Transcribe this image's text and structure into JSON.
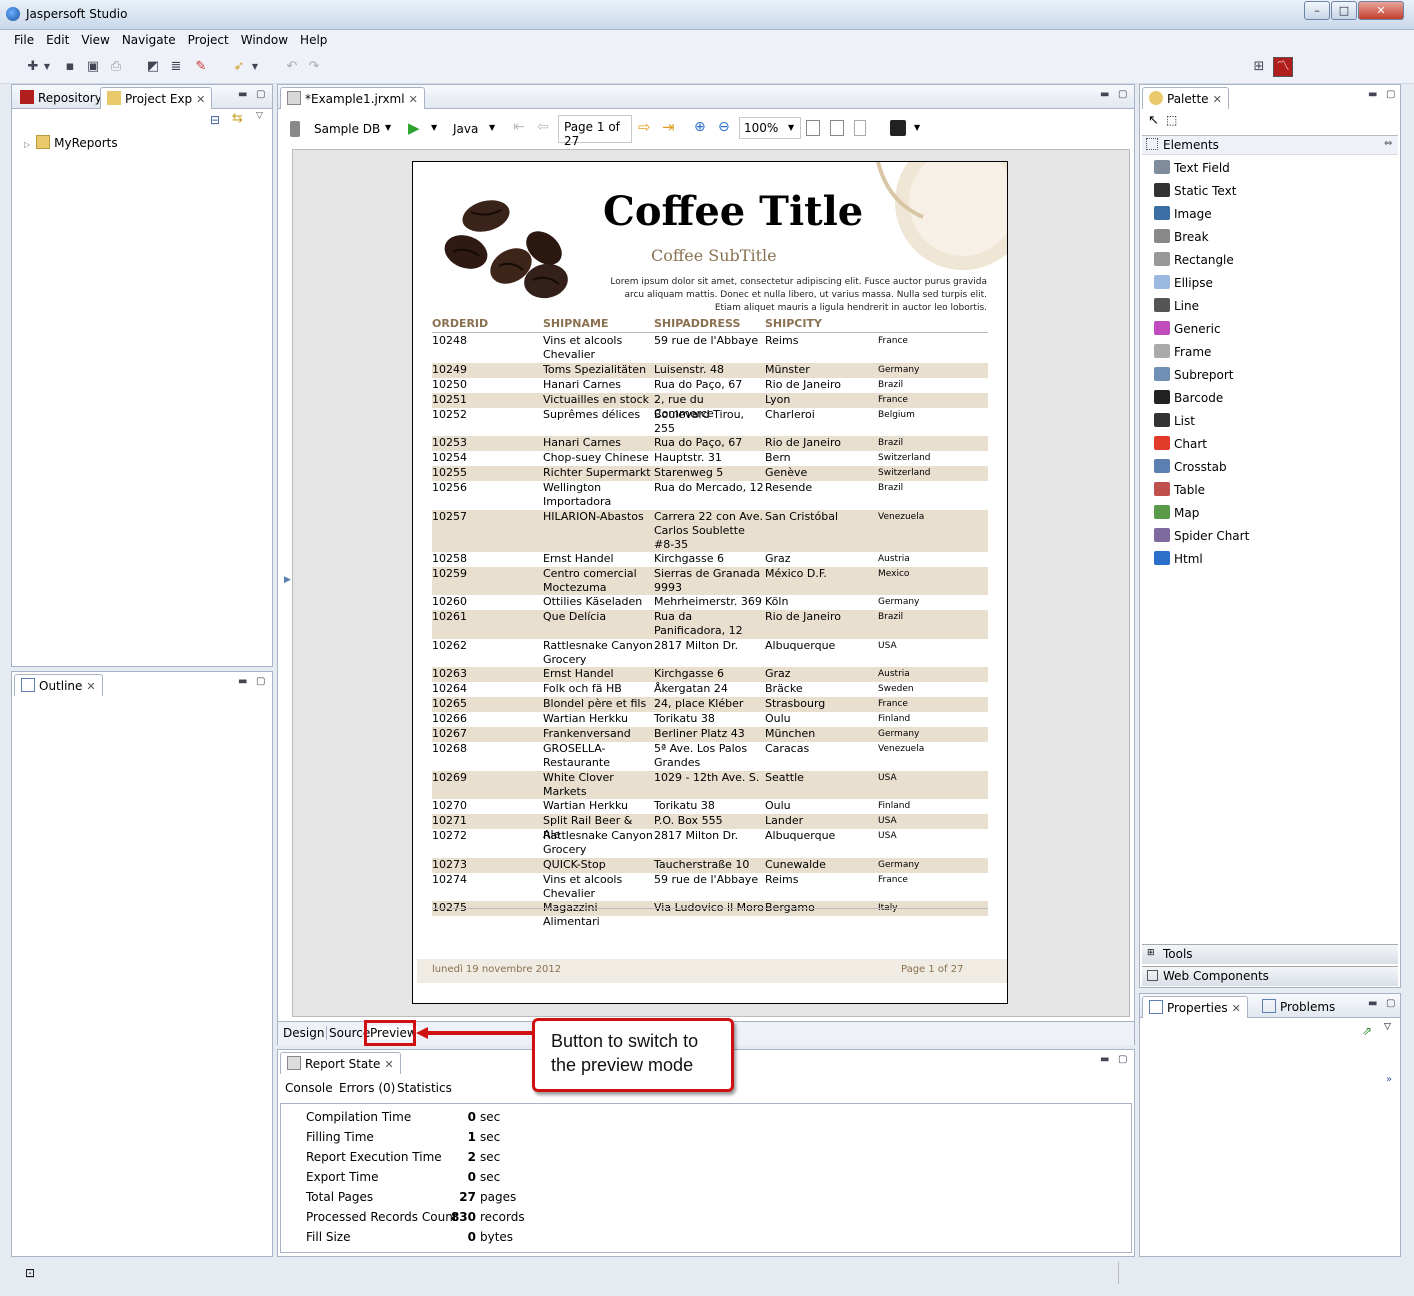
{
  "app": {
    "title": "Jaspersoft Studio"
  },
  "window_controls": {
    "minimize": "–",
    "maximize": "□",
    "close": "✕"
  },
  "menu": [
    "File",
    "Edit",
    "View",
    "Navigate",
    "Project",
    "Window",
    "Help"
  ],
  "left_panel": {
    "tabs": [
      "Repository",
      "Project Exp"
    ],
    "tree": [
      {
        "label": "MyReports"
      }
    ]
  },
  "outline_panel": {
    "tab": "Outline"
  },
  "editor": {
    "tab": "*Example1.jrxml",
    "datasource": "Sample DB",
    "language": "Java",
    "page_indicator": "Page 1 of 27",
    "zoom": "100%",
    "bottom_tabs": [
      "Design",
      "Source",
      "Preview"
    ]
  },
  "report": {
    "title": "Coffee Title",
    "subtitle": "Coffee SubTitle",
    "lorem": "Lorem ipsum dolor sit amet, consectetur adipiscing elit. Fusce auctor purus gravida arcu aliquam mattis. Donec et nulla libero, ut varius massa. Nulla sed turpis elit. Etiam aliquet mauris a ligula hendrerit in auctor leo lobortis.",
    "columns": [
      "ORDERID",
      "SHIPNAME",
      "SHIPADDRESS",
      "SHIPCITY"
    ],
    "rows": [
      {
        "id": "10248",
        "name": "Vins et alcools Chevalier",
        "addr": "59 rue de l'Abbaye",
        "city": "Reims",
        "country": "France",
        "lines": 2
      },
      {
        "id": "10249",
        "name": "Toms Spezialitäten",
        "addr": "Luisenstr. 48",
        "city": "Münster",
        "country": "Germany",
        "lines": 1
      },
      {
        "id": "10250",
        "name": "Hanari Carnes",
        "addr": "Rua do Paço, 67",
        "city": "Rio de Janeiro",
        "country": "Brazil",
        "lines": 1
      },
      {
        "id": "10251",
        "name": "Victuailles en stock",
        "addr": "2, rue du Commerce",
        "city": "Lyon",
        "country": "France",
        "lines": 1
      },
      {
        "id": "10252",
        "name": "Suprêmes délices",
        "addr": "Boulevard Tirou, 255",
        "city": "Charleroi",
        "country": "Belgium",
        "lines": 2
      },
      {
        "id": "10253",
        "name": "Hanari Carnes",
        "addr": "Rua do Paço, 67",
        "city": "Rio de Janeiro",
        "country": "Brazil",
        "lines": 1
      },
      {
        "id": "10254",
        "name": "Chop-suey Chinese",
        "addr": "Hauptstr. 31",
        "city": "Bern",
        "country": "Switzerland",
        "lines": 1
      },
      {
        "id": "10255",
        "name": "Richter Supermarkt",
        "addr": "Starenweg 5",
        "city": "Genève",
        "country": "Switzerland",
        "lines": 1
      },
      {
        "id": "10256",
        "name": "Wellington Importadora",
        "addr": "Rua do Mercado, 12",
        "city": "Resende",
        "country": "Brazil",
        "lines": 2
      },
      {
        "id": "10257",
        "name": "HILARION-Abastos",
        "addr": "Carrera 22 con Ave. Carlos Soublette #8-35",
        "city": "San Cristóbal",
        "country": "Venezuela",
        "lines": 3
      },
      {
        "id": "10258",
        "name": "Ernst Handel",
        "addr": "Kirchgasse 6",
        "city": "Graz",
        "country": "Austria",
        "lines": 1
      },
      {
        "id": "10259",
        "name": "Centro comercial Moctezuma",
        "addr": "Sierras de Granada 9993",
        "city": "México D.F.",
        "country": "Mexico",
        "lines": 2
      },
      {
        "id": "10260",
        "name": "Ottilies Käseladen",
        "addr": "Mehrheimerstr. 369",
        "city": "Köln",
        "country": "Germany",
        "lines": 1
      },
      {
        "id": "10261",
        "name": "Que Delícia",
        "addr": "Rua da Panificadora, 12",
        "city": "Rio de Janeiro",
        "country": "Brazil",
        "lines": 2
      },
      {
        "id": "10262",
        "name": "Rattlesnake Canyon Grocery",
        "addr": "2817 Milton Dr.",
        "city": "Albuquerque",
        "country": "USA",
        "lines": 2
      },
      {
        "id": "10263",
        "name": "Ernst Handel",
        "addr": "Kirchgasse 6",
        "city": "Graz",
        "country": "Austria",
        "lines": 1
      },
      {
        "id": "10264",
        "name": "Folk och fä HB",
        "addr": "Åkergatan 24",
        "city": "Bräcke",
        "country": "Sweden",
        "lines": 1
      },
      {
        "id": "10265",
        "name": "Blondel père et fils",
        "addr": "24, place Kléber",
        "city": "Strasbourg",
        "country": "France",
        "lines": 1
      },
      {
        "id": "10266",
        "name": "Wartian Herkku",
        "addr": "Torikatu 38",
        "city": "Oulu",
        "country": "Finland",
        "lines": 1
      },
      {
        "id": "10267",
        "name": "Frankenversand",
        "addr": "Berliner Platz 43",
        "city": "München",
        "country": "Germany",
        "lines": 1
      },
      {
        "id": "10268",
        "name": "GROSELLA-Restaurante",
        "addr": "5ª Ave. Los Palos Grandes",
        "city": "Caracas",
        "country": "Venezuela",
        "lines": 2
      },
      {
        "id": "10269",
        "name": "White Clover Markets",
        "addr": "1029 - 12th Ave. S.",
        "city": "Seattle",
        "country": "USA",
        "lines": 2
      },
      {
        "id": "10270",
        "name": "Wartian Herkku",
        "addr": "Torikatu 38",
        "city": "Oulu",
        "country": "Finland",
        "lines": 1
      },
      {
        "id": "10271",
        "name": "Split Rail Beer & Ale",
        "addr": "P.O. Box 555",
        "city": "Lander",
        "country": "USA",
        "lines": 1
      },
      {
        "id": "10272",
        "name": "Rattlesnake Canyon Grocery",
        "addr": "2817 Milton Dr.",
        "city": "Albuquerque",
        "country": "USA",
        "lines": 2
      },
      {
        "id": "10273",
        "name": "QUICK-Stop",
        "addr": "Taucherstraße 10",
        "city": "Cunewalde",
        "country": "Germany",
        "lines": 1
      },
      {
        "id": "10274",
        "name": "Vins et alcools Chevalier",
        "addr": "59 rue de l'Abbaye",
        "city": "Reims",
        "country": "France",
        "lines": 2
      },
      {
        "id": "10275",
        "name": "Magazzini Alimentari",
        "addr": "Via Ludovico il Moro",
        "city": "Bergamo",
        "country": "Italy",
        "lines": 1
      }
    ],
    "footer_date": "lunedì 19 novembre 2012",
    "footer_page": "Page 1 of 27"
  },
  "palette": {
    "tab": "Palette",
    "section": "Elements",
    "items": [
      {
        "label": "Text Field",
        "icon": "text-field-icon",
        "color": "#7f8c9c"
      },
      {
        "label": "Static Text",
        "icon": "static-text-icon",
        "color": "#333333"
      },
      {
        "label": "Image",
        "icon": "image-icon",
        "color": "#3a6ea5"
      },
      {
        "label": "Break",
        "icon": "break-icon",
        "color": "#888888"
      },
      {
        "label": "Rectangle",
        "icon": "rectangle-icon",
        "color": "#999999"
      },
      {
        "label": "Ellipse",
        "icon": "ellipse-icon",
        "color": "#9ab8e0"
      },
      {
        "label": "Line",
        "icon": "line-icon",
        "color": "#555555"
      },
      {
        "label": "Generic",
        "icon": "generic-icon",
        "color": "#c04bbd"
      },
      {
        "label": "Frame",
        "icon": "frame-icon",
        "color": "#aaaaaa"
      },
      {
        "label": "Subreport",
        "icon": "subreport-icon",
        "color": "#6f8fb5"
      },
      {
        "label": "Barcode",
        "icon": "barcode-icon",
        "color": "#222222"
      },
      {
        "label": "List",
        "icon": "list-icon",
        "color": "#333333"
      },
      {
        "label": "Chart",
        "icon": "chart-icon",
        "color": "#e23b2a"
      },
      {
        "label": "Crosstab",
        "icon": "crosstab-icon",
        "color": "#5b7fb0"
      },
      {
        "label": "Table",
        "icon": "table-icon",
        "color": "#c0504d"
      },
      {
        "label": "Map",
        "icon": "map-icon",
        "color": "#5a9a4a"
      },
      {
        "label": "Spider Chart",
        "icon": "spider-chart-icon",
        "color": "#7f6aa0"
      },
      {
        "label": "Html",
        "icon": "html-icon",
        "color": "#2a6fc9"
      }
    ],
    "tools": "Tools",
    "web_components": "Web Components"
  },
  "properties_panel": {
    "tabs": [
      "Properties",
      "Problems"
    ]
  },
  "report_state": {
    "tab": "Report State",
    "subtabs": [
      "Console",
      "Errors (0)",
      "Statistics"
    ],
    "stats": [
      {
        "label": "Compilation Time",
        "value": "0",
        "unit": "sec"
      },
      {
        "label": "Filling Time",
        "value": "1",
        "unit": "sec"
      },
      {
        "label": "Report Execution Time",
        "value": "2",
        "unit": "sec"
      },
      {
        "label": "Export Time",
        "value": "0",
        "unit": "sec"
      },
      {
        "label": "Total Pages",
        "value": "27",
        "unit": "pages"
      },
      {
        "label": "Processed Records Count",
        "value": "830",
        "unit": "records"
      },
      {
        "label": "Fill Size",
        "value": "0",
        "unit": "bytes"
      }
    ]
  },
  "callout": {
    "text_line1": "Button to switch to",
    "text_line2": "the preview mode"
  },
  "colors": {
    "accent_red": "#d01010",
    "report_brown": "#8a7150",
    "row_alt": "#e8dfcf"
  }
}
